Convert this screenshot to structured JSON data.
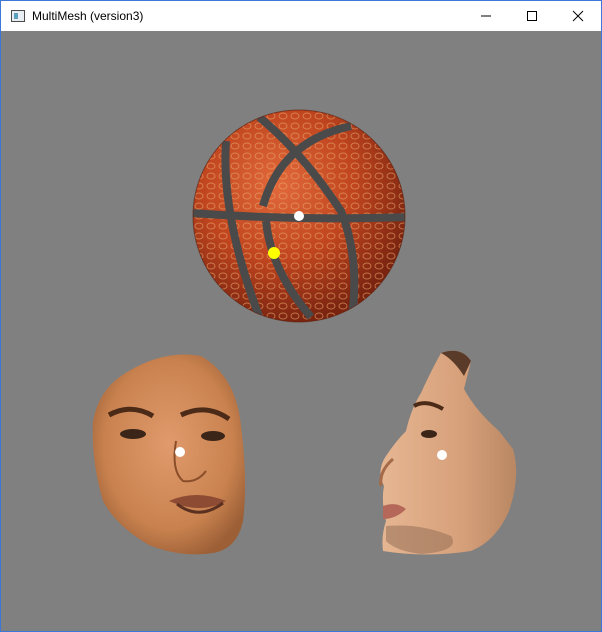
{
  "window": {
    "title": "MultiMesh (version3)",
    "icon": "app-icon",
    "controls": [
      "minimize-icon",
      "maximize-icon",
      "close-icon"
    ]
  },
  "scene": {
    "background_color": "#808080",
    "objects": [
      {
        "name": "basketball",
        "marker_colors": [
          "#ffffff",
          "#ffff00"
        ]
      },
      {
        "name": "face-front",
        "marker_colors": [
          "#ffffff"
        ]
      },
      {
        "name": "face-side",
        "marker_colors": [
          "#ffffff"
        ]
      }
    ]
  }
}
